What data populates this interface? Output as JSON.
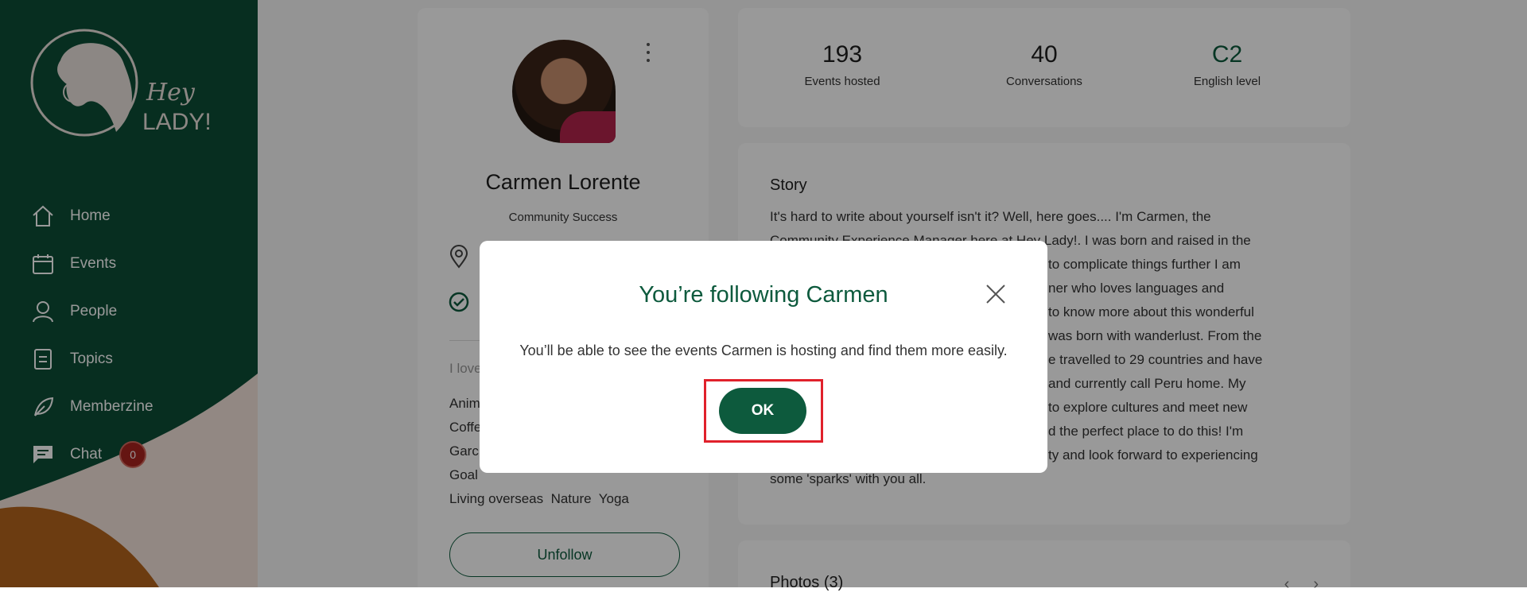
{
  "sidebar": {
    "logo_text_1": "Hey",
    "logo_text_2": "LADY!",
    "items": [
      {
        "label": "Home",
        "icon": "home-icon"
      },
      {
        "label": "Events",
        "icon": "calendar-icon"
      },
      {
        "label": "People",
        "icon": "person-icon"
      },
      {
        "label": "Topics",
        "icon": "document-icon"
      },
      {
        "label": "Memberzine",
        "icon": "leaf-icon"
      },
      {
        "label": "Chat",
        "icon": "chat-icon",
        "badge": "0"
      }
    ]
  },
  "profile": {
    "name": "Carmen Lorente",
    "role": "Community Success",
    "loves_label": "I love",
    "interests_lines": [
      "Anim",
      "Coffe",
      "Garc",
      "Goal",
      "Living overseas  Nature  Yoga"
    ],
    "unfollow_label": "Unfollow"
  },
  "stats": [
    {
      "value": "193",
      "label": "Events hosted"
    },
    {
      "value": "40",
      "label": "Conversations"
    },
    {
      "value": "C2",
      "label": "English level"
    }
  ],
  "story": {
    "title": "Story",
    "lines": [
      "It's hard to write about yourself isn't it? Well, here goes.... I'm Carmen, the",
      "Community Experience Manager here at Hey Lady!. I was born and raised in the",
      "to complicate things further I am",
      "ner who loves languages and",
      "to know more about this wonderful",
      "was born with wanderlust. From the",
      "e travelled to 29 countries and have",
      "and currently call Peru home. My",
      "to explore cultures and meet new",
      "d the perfect place to do this! I'm",
      "ty and look forward to experiencing",
      "some 'sparks' with you all."
    ]
  },
  "photos": {
    "title": "Photos (3)"
  },
  "modal": {
    "title": "You’re following Carmen",
    "message": "You’ll be able to see the events Carmen is hosting and find them more easily.",
    "ok_label": "OK"
  },
  "colors": {
    "brand_green": "#0d5a3d",
    "badge_red": "#a8231e",
    "highlight_red": "#e0212b"
  }
}
